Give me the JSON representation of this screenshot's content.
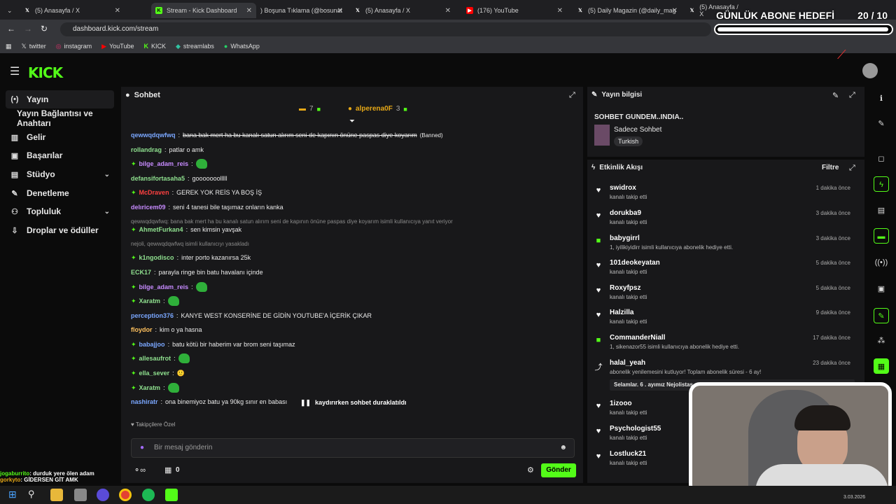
{
  "tabs": [
    {
      "label": "(5) Anasayfa / X"
    },
    {
      "label": "Stream - Kick Dashboard"
    },
    {
      "label": ") Boşuna Tıklama (@bosunat"
    },
    {
      "label": "(5) Anasayfa / X"
    },
    {
      "label": "(176) YouTube"
    },
    {
      "label": "(5) Daily Magazin (@daily_mag"
    },
    {
      "label": "(5) Anasayfa / X"
    }
  ],
  "url": "dashboard.kick.com/stream",
  "bookmarks": [
    "twitter",
    "instagram",
    "YouTube",
    "KICK",
    "streamlabs",
    "WhatsApp"
  ],
  "goal": {
    "title": "GÜNLÜK ABONE HEDEFİ",
    "count": "20  / 10",
    "progress": 1.0
  },
  "logo": "KICK",
  "sidebar": [
    {
      "label": "Yayın"
    },
    {
      "label": "Yayın Bağlantısı ve Anahtarı"
    },
    {
      "label": "Gelir"
    },
    {
      "label": "Başarılar"
    },
    {
      "label": "Stüdyo"
    },
    {
      "label": "Denetleme"
    },
    {
      "label": "Topluluk"
    },
    {
      "label": "Droplar ve ödüller"
    }
  ],
  "chat": {
    "title": "Sohbet",
    "pinned": [
      {
        "user": "",
        "count": "7"
      },
      {
        "user": "alperena0F",
        "count": "3"
      }
    ],
    "messages": [
      {
        "user": "qewwqdqwfwq",
        "text": "bana bak mert ha bu kanalı satun alırım seni de kapının önüne paspas diye koyarım",
        "suffix": "(Banned)",
        "color": "#7aa7ff"
      },
      {
        "user": "rollandrag",
        "text": "patlar o amk",
        "color": "#8fe08f"
      },
      {
        "user": "bilge_adam_reis",
        "text": "",
        "color": "#c78bff",
        "emote": true,
        "badge": true
      },
      {
        "user": "defansifortasaha5",
        "text": "gooooooolllll",
        "color": "#8fe08f"
      },
      {
        "user": "McDraven",
        "text": "GEREK YOK REİS YA BOŞ İŞ",
        "color": "#ff4040",
        "badge": true
      },
      {
        "user": "delıricem09",
        "text": "seni 4 tanesi bile taşımaz onların kanka",
        "color": "#c78bff"
      },
      {
        "user": "",
        "text": "qewwqdqwfwq: bana bak mert ha bu kanalı satun alırım seni de kapının önüne paspas diye koyarım isimli kullanıcıya yanıt veriyor",
        "color": "#888",
        "sys": true
      },
      {
        "user": "AhmetFurkan4",
        "text": "sen kimsin yavşak",
        "color": "#8fe08f",
        "badge": true
      },
      {
        "user": "",
        "text": "nejoli, qewwqdqwfwq isimli kullanıcıyı yasakladı",
        "color": "#888",
        "sys": true
      },
      {
        "user": "k1ngodisco",
        "text": "inter porto kazanırsa 25k",
        "color": "#8fe08f",
        "badge": true
      },
      {
        "user": "ECK17",
        "text": "parayla ringe bin batu havalanı içinde",
        "color": "#8fe08f"
      },
      {
        "user": "bilge_adam_reis",
        "text": "",
        "color": "#c78bff",
        "emote": true,
        "badge": true
      },
      {
        "user": "Xaratm",
        "text": "",
        "color": "#8fe08f",
        "emote": true,
        "badge": true
      },
      {
        "user": "perception376",
        "text": "KANYE WEST KONSERİNE DE GİDİN YOUTUBE'A İÇERİK ÇIKAR",
        "color": "#7aa7ff"
      },
      {
        "user": "floydor",
        "text": "kim o ya hasna",
        "color": "#ffc15e"
      },
      {
        "user": "babajjoo",
        "text": "batu kötü bir haberim var brom seni taşımaz",
        "color": "#7aa7ff",
        "badge": true
      },
      {
        "user": "allesaufrot",
        "text": "",
        "color": "#8fe08f",
        "emote": true,
        "badge": true
      },
      {
        "user": "ella_sever",
        "text": "🙂",
        "color": "#8fe08f",
        "badge": true
      },
      {
        "user": "Xaratm",
        "text": "",
        "color": "#8fe08f",
        "emote": true,
        "badge": true
      },
      {
        "user": "nashiratr",
        "text": "ona binemiyoz batu ya 90kg sınır en babası",
        "color": "#7aa7ff"
      }
    ],
    "paused": "kaydırırken sohbet duraklatıldı",
    "followers_only": "Takipçilere Özel",
    "input_placeholder": "Bir mesaj gönderin",
    "count": "0",
    "send": "Gönder"
  },
  "info": {
    "title": "Yayın bilgisi",
    "stream_title": "SOHBET GUNDEM..INDIA..",
    "category": "Sadece Sohbet",
    "language": "Turkish"
  },
  "activity": {
    "title": "Etkinlik Akışı",
    "filter": "Filtre",
    "items": [
      {
        "name": "swidrox",
        "sub": "kanalı takip etti",
        "time": "1 dakika önce",
        "icon": "heart"
      },
      {
        "name": "dorukba9",
        "sub": "kanalı takip etti",
        "time": "3 dakika önce",
        "icon": "heart"
      },
      {
        "name": "babygirrl",
        "sub": "1, iyilikiyidirr isimli kullanıcıya abonelik hediye etti.",
        "time": "3 dakika önce",
        "icon": "gift"
      },
      {
        "name": "101deokeyatan",
        "sub": "kanalı takip etti",
        "time": "5 dakika önce",
        "icon": "heart"
      },
      {
        "name": "Roxyfpsz",
        "sub": "kanalı takip etti",
        "time": "5 dakika önce",
        "icon": "heart"
      },
      {
        "name": "Halzilla",
        "sub": "kanalı takip etti",
        "time": "9 dakika önce",
        "icon": "heart"
      },
      {
        "name": "CommanderNiall",
        "sub": "1, sikenazor55 isimli kullanıcıya abonelik hediye etti.",
        "time": "17 dakika önce",
        "icon": "gift"
      },
      {
        "name": "halal_yeah",
        "sub": "abonelik yenilemesini kutluyor! Toplam abonelik süresi - 6 ay!",
        "time": "23 dakika önce",
        "icon": "star",
        "note": "Selamlar. 6 . ayımız Nejolistas ca"
      },
      {
        "name": "1izooo",
        "sub": "kanalı takip etti",
        "time": "",
        "icon": "heart"
      },
      {
        "name": "Psychologist55",
        "sub": "kanalı takip etti",
        "time": "",
        "icon": "heart"
      },
      {
        "name": "Lostluck21",
        "sub": "kanalı takip etti",
        "time": "",
        "icon": "heart"
      }
    ]
  },
  "overlay_chat": [
    {
      "user": "jogaburrito",
      "text": ": durduk yere ölen adam"
    },
    {
      "user": "gorkyto",
      "text": ": GİDERSEN GİT AMK"
    }
  ],
  "date": "3.03.2026"
}
